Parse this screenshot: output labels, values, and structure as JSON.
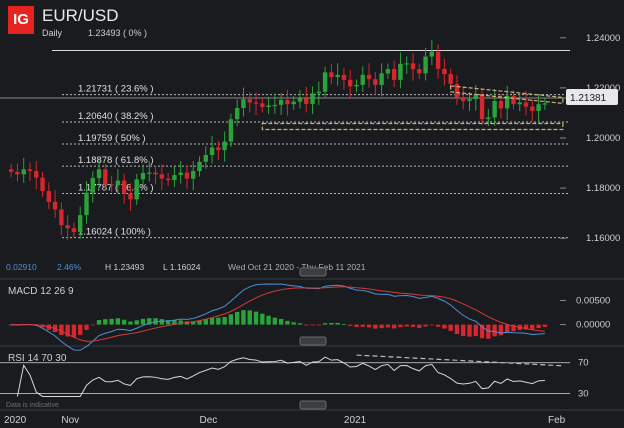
{
  "header": {
    "logo": "IG",
    "symbol": "EUR/USD",
    "timeframe": "Daily",
    "last_value": "1.23493 ( 0% )"
  },
  "info_bar": {
    "change": "0.02910",
    "change_pct": "2.46%",
    "high": "H 1.23493",
    "low": "L 1.16024",
    "range": "Wed Oct 21 2020 - Thu Feb 11 2021"
  },
  "price_badge": "1.21381",
  "note": "Data is indicative",
  "colors": {
    "up": "#2aa33b",
    "down": "#d5272d",
    "fib": "#bfbfbf",
    "macd": "#4f8fd8",
    "signal": "#d43a3a",
    "rsi": "#d8d8d8",
    "accent": "#e5241f"
  },
  "chart_data": [
    {
      "type": "candlestick",
      "title": "EUR/USD",
      "y_ticks": [
        "1.24000",
        "1.22000",
        "1.20000",
        "1.18000",
        "1.16000"
      ],
      "x_ticks": [
        "2020",
        "Nov",
        "Dec",
        "2021",
        "Feb"
      ],
      "fibonacci": [
        {
          "label": "1.23493 ( 0% )",
          "value": 1.23493
        },
        {
          "label": "1.21731 ( 23.6% )",
          "value": 1.21731
        },
        {
          "label": "1.20640 ( 38.2% )",
          "value": 1.2064
        },
        {
          "label": "1.19759 ( 50% )",
          "value": 1.19759
        },
        {
          "label": "1.18878 ( 61.8% )",
          "value": 1.18878
        },
        {
          "label": "1.17787 ( 76.4% )",
          "value": 1.17787
        },
        {
          "label": "1.16024 ( 100% )",
          "value": 1.16024
        }
      ],
      "close": [
        1.1865,
        1.1855,
        1.1875,
        1.1868,
        1.1842,
        1.1788,
        1.1745,
        1.1715,
        1.1652,
        1.164,
        1.1625,
        1.1692,
        1.1782,
        1.184,
        1.1875,
        1.1815,
        1.1812,
        1.183,
        1.1778,
        1.1755,
        1.1835,
        1.186,
        1.1862,
        1.1855,
        1.1838,
        1.1832,
        1.1852,
        1.1862,
        1.1838,
        1.1868,
        1.1905,
        1.1932,
        1.1962,
        1.1952,
        1.1986,
        1.2075,
        1.212,
        1.2155,
        1.2142,
        1.2138,
        1.2124,
        1.213,
        1.2132,
        1.2152,
        1.2135,
        1.2145,
        1.2158,
        1.2136,
        1.2178,
        1.2185,
        1.2262,
        1.2243,
        1.2252,
        1.2232,
        1.2206,
        1.2212,
        1.2252,
        1.2235,
        1.2212,
        1.2258,
        1.2275,
        1.2232,
        1.2296,
        1.2298,
        1.2275,
        1.2258,
        1.2325,
        1.2345,
        1.2276,
        1.2255,
        1.2216,
        1.216,
        1.2148,
        1.2155,
        1.2172,
        1.2075,
        1.2082,
        1.2148,
        1.2118,
        1.2168,
        1.2135,
        1.2142,
        1.2125,
        1.2108,
        1.2135,
        1.2138
      ],
      "open_first": 1.1875
    },
    {
      "type": "line",
      "title": "MACD 12 26 9",
      "y_ticks": [
        "0.00500",
        "0.00000"
      ]
    },
    {
      "type": "line",
      "title": "RSI 14 70 30",
      "y_ticks": [
        "70",
        "30"
      ]
    }
  ]
}
